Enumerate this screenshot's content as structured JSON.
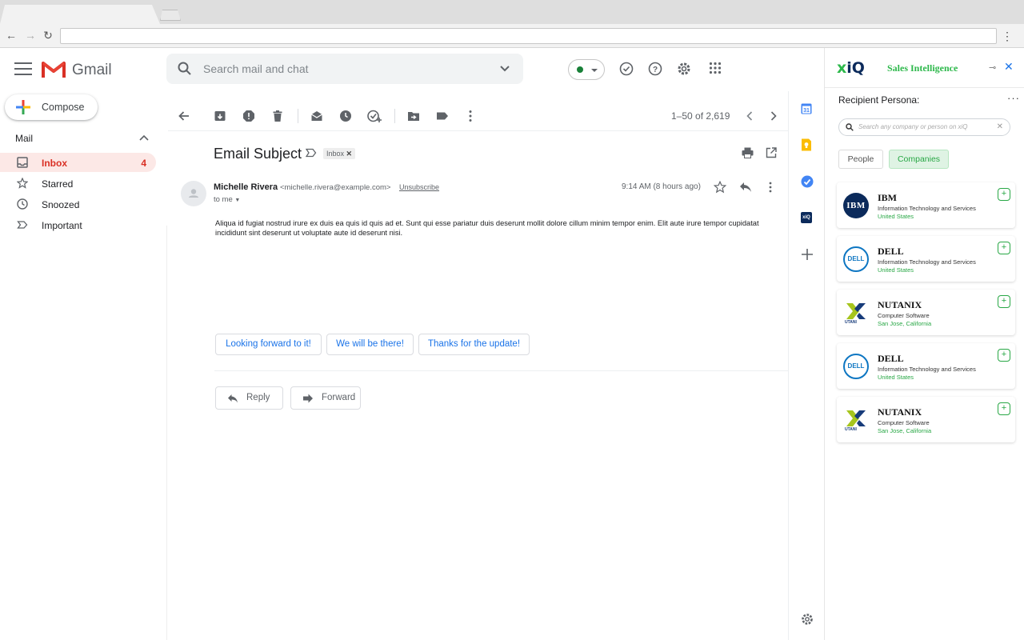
{
  "header": {
    "app_name": "Gmail",
    "search_placeholder": "Search mail and chat"
  },
  "nav": {
    "compose": "Compose",
    "section": "Mail",
    "items": [
      {
        "label": "Inbox",
        "count": "4"
      },
      {
        "label": "Starred",
        "count": ""
      },
      {
        "label": "Snoozed",
        "count": ""
      },
      {
        "label": "Important",
        "count": ""
      }
    ]
  },
  "toolbar": {
    "pager": "1–50 of 2,619"
  },
  "email": {
    "subject": "Email Subject",
    "label_chip": "Inbox",
    "sender_name": "Michelle Rivera",
    "sender_email": "<michelle.rivera@example.com>",
    "unsubscribe": "Unsubscribe",
    "to": "to me",
    "time": "9:14 AM (8 hours ago)",
    "body": "Aliqua id fugiat nostrud irure ex duis ea quis id quis ad et. Sunt qui esse pariatur duis deserunt mollit dolore cillum minim tempor enim. Elit aute irure tempor cupidatat incididunt sint deserunt ut voluptate aute id deserunt nisi.",
    "smart_replies": [
      "Looking forward to it!",
      "We will be there!",
      "Thanks for the update!"
    ],
    "reply": "Reply",
    "forward": "Forward"
  },
  "rail": {
    "calendar_day": "31"
  },
  "xiq": {
    "logo_x": "x",
    "logo_iq": "iQ",
    "title": "Sales Intelligence",
    "persona_label": "Recipient Persona:",
    "search_placeholder": "Search any company or person on xiQ",
    "tab_people": "People",
    "tab_companies": "Companies",
    "companies": [
      {
        "name": "IBM",
        "industry": "Information Technology and Services",
        "location": "United States",
        "logo": "IBM"
      },
      {
        "name": "DELL",
        "industry": "Information Technology and Services",
        "location": "United States",
        "logo": "DELL"
      },
      {
        "name": "NUTANIX",
        "industry": "Computer Software",
        "location": "San Jose, California",
        "logo": "UTANI"
      },
      {
        "name": "DELL",
        "industry": "Information Technology and Services",
        "location": "United States",
        "logo": "DELL"
      },
      {
        "name": "NUTANIX",
        "industry": "Computer Software",
        "location": "San Jose, California",
        "logo": "UTANI"
      }
    ]
  },
  "colors": {
    "gmail_red": "#d93025",
    "link_blue": "#1a73e8",
    "xiq_green": "#2db84b"
  }
}
